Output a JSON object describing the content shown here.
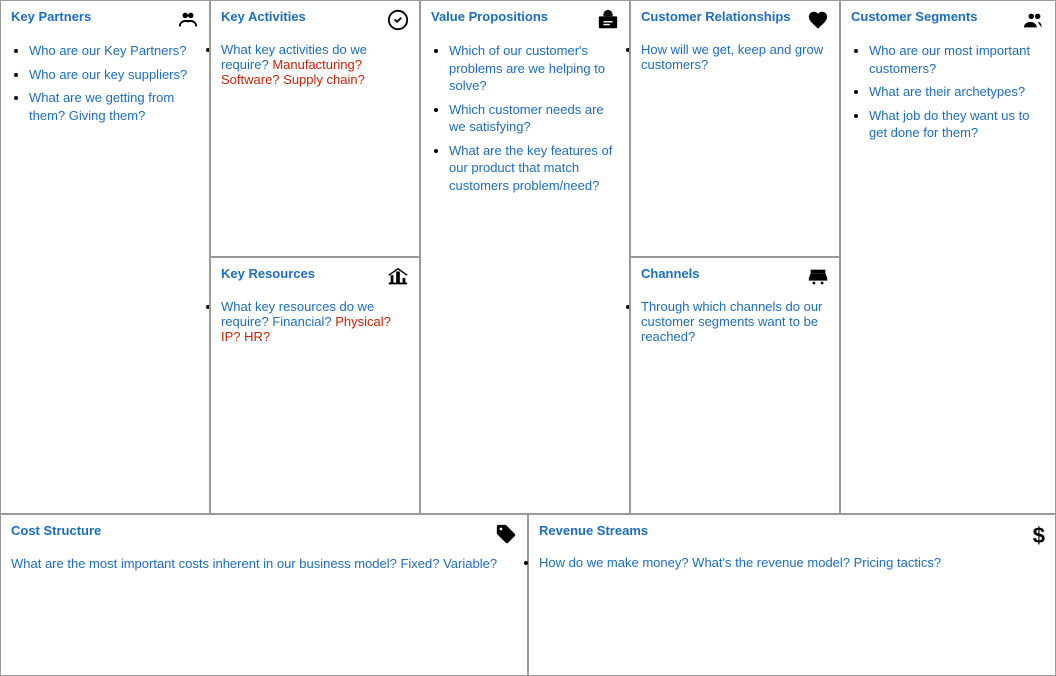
{
  "sections": {
    "keyPartners": {
      "title": "Key Partners",
      "items": [
        {
          "parts": [
            {
              "text": "Who are our Key Partners?",
              "color": "blue"
            }
          ]
        },
        {
          "parts": [
            {
              "text": "Who are our key suppliers?",
              "color": "blue"
            }
          ]
        },
        {
          "parts": [
            {
              "text": "What are we getting from them? Giving them?",
              "color": "blue"
            }
          ]
        }
      ]
    },
    "keyActivities": {
      "title": "Key Activities",
      "items": [
        {
          "parts": [
            {
              "text": "What key activities do we require? ",
              "color": "blue"
            },
            {
              "text": "Manufacturing? Software? Supply chain?",
              "color": "red"
            }
          ]
        }
      ]
    },
    "keyResources": {
      "title": "Key Resources",
      "items": [
        {
          "parts": [
            {
              "text": "What key resources do we require? Financial? ",
              "color": "blue"
            },
            {
              "text": "Physical? IP? HR?",
              "color": "red"
            }
          ]
        }
      ]
    },
    "valuePropositions": {
      "title": "Value Propositions",
      "items": [
        {
          "parts": [
            {
              "text": "Which of our customer's problems are we helping to solve?",
              "color": "blue"
            }
          ]
        },
        {
          "parts": [
            {
              "text": "Which customer needs are we satisfying?",
              "color": "blue"
            }
          ]
        },
        {
          "parts": [
            {
              "text": "What are the key features of our product that match customers problem/need?",
              "color": "blue"
            }
          ]
        }
      ]
    },
    "customerRelationships": {
      "title": "Customer Relationships",
      "items": [
        {
          "parts": [
            {
              "text": "How will we get, keep and grow customers?",
              "color": "blue"
            }
          ]
        }
      ]
    },
    "channels": {
      "title": "Channels",
      "items": [
        {
          "parts": [
            {
              "text": "Through which channels do our customer segments want to be reached?",
              "color": "blue"
            }
          ]
        }
      ]
    },
    "customerSegments": {
      "title": "Customer Segments",
      "items": [
        {
          "parts": [
            {
              "text": "Who are our most important customers?",
              "color": "blue"
            }
          ]
        },
        {
          "parts": [
            {
              "text": "What are their archetypes?",
              "color": "blue"
            }
          ]
        },
        {
          "parts": [
            {
              "text": "What job do they want us to get done for them?",
              "color": "blue"
            }
          ]
        }
      ]
    },
    "costStructure": {
      "title": "Cost Structure",
      "items": [
        {
          "parts": [
            {
              "text": "What are the most important costs inherent in our business model? Fixed? Variable?",
              "color": "blue"
            }
          ]
        }
      ]
    },
    "revenueStreams": {
      "title": "Revenue Streams",
      "items": [
        {
          "parts": [
            {
              "text": "How do we make money? What's the revenue model? Pricing tactics?",
              "color": "blue"
            }
          ]
        }
      ]
    }
  }
}
